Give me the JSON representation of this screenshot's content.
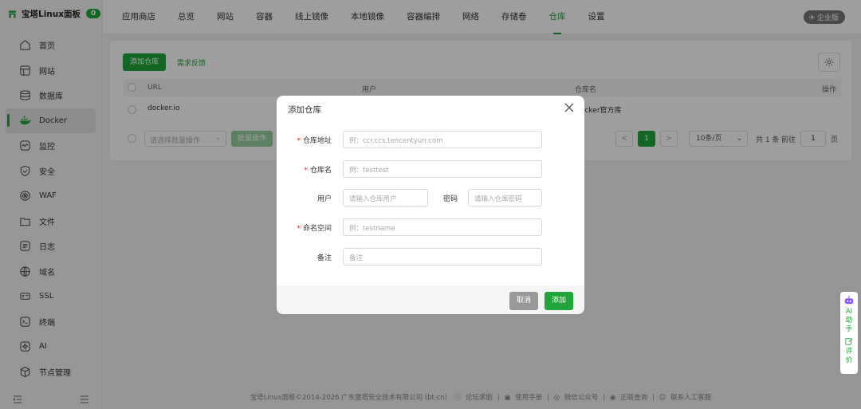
{
  "brand": {
    "name": "宝塔Linux面板",
    "badge": "0"
  },
  "sidebar": {
    "items": [
      {
        "label": "首页",
        "icon": "home-icon"
      },
      {
        "label": "网站",
        "icon": "website-icon"
      },
      {
        "label": "数据库",
        "icon": "database-icon"
      },
      {
        "label": "Docker",
        "icon": "docker-icon",
        "active": true
      },
      {
        "label": "监控",
        "icon": "monitor-icon"
      },
      {
        "label": "安全",
        "icon": "shield-icon"
      },
      {
        "label": "WAF",
        "icon": "waf-icon"
      },
      {
        "label": "文件",
        "icon": "folder-icon"
      },
      {
        "label": "日志",
        "icon": "log-icon"
      },
      {
        "label": "域名",
        "icon": "globe-icon"
      },
      {
        "label": "SSL",
        "icon": "ssl-icon"
      },
      {
        "label": "终端",
        "icon": "terminal-icon"
      },
      {
        "label": "AI",
        "icon": "ai-icon"
      },
      {
        "label": "节点管理",
        "icon": "node-icon"
      }
    ]
  },
  "topnav": {
    "tabs": [
      "应用商店",
      "总览",
      "网站",
      "容器",
      "线上镜像",
      "本地镜像",
      "容器编排",
      "网络",
      "存储卷",
      "仓库",
      "设置"
    ],
    "active_index": 9,
    "enterprise": "企业版"
  },
  "toolbar": {
    "add_repo": "添加仓库",
    "feedback": "需求反馈"
  },
  "table": {
    "headers": [
      "URL",
      "用户",
      "仓库名",
      "操作"
    ],
    "rows": [
      {
        "url": "docker.io",
        "user": "",
        "name": "Docker官方库"
      }
    ]
  },
  "bulk": {
    "placeholder": "请选择批量操作",
    "button": "批量操作"
  },
  "pagination": {
    "prev": "<",
    "page": "1",
    "next": ">",
    "per_page": "10条/页",
    "total": "共 1 条",
    "goto": "前往",
    "goto_page": "1",
    "page_unit": "页"
  },
  "footer": {
    "copyright": "宝塔Linux面板©2014-2026 广东堡塔安全技术有限公司 (bt.cn)",
    "links": [
      "论坛求助",
      "使用手册",
      "微信公众号",
      "正版查询",
      "联系人工客服"
    ]
  },
  "ai_helper": {
    "label1": "AI",
    "label2": "助",
    "label3": "手",
    "label4": "评",
    "label5": "价"
  },
  "modal": {
    "title": "添加仓库",
    "fields": {
      "address": {
        "label": "仓库地址",
        "placeholder": "例：ccr.ccs.tencentyun.com"
      },
      "name": {
        "label": "仓库名",
        "placeholder": "例：testtest"
      },
      "user": {
        "label": "用户",
        "placeholder": "请输入仓库用户"
      },
      "password": {
        "label": "密码",
        "placeholder": "请输入仓库密码"
      },
      "namespace": {
        "label": "命名空间",
        "placeholder": "例：testname"
      },
      "remark": {
        "label": "备注",
        "placeholder": "备注"
      }
    },
    "required_mark": "*",
    "cancel": "取消",
    "submit": "添加"
  },
  "colors": {
    "accent": "#20a53a",
    "required": "#e02020"
  }
}
